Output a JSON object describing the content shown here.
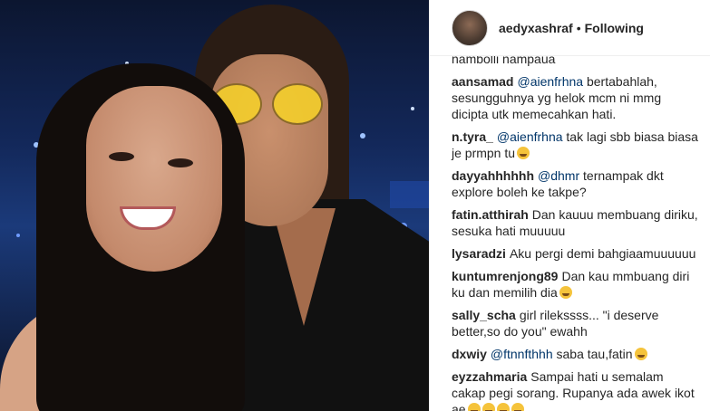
{
  "post": {
    "image_icon": "selfie-photo"
  },
  "header": {
    "username": "aedyxashraf",
    "separator": "•",
    "follow_status": "Following"
  },
  "comments": {
    "partial_top": "nambolli nampaua",
    "items": [
      {
        "user": "aansamad",
        "mention": "@aienfrhna",
        "text": "bertabahlah, sesungguhnya yg helok mcm ni mmg dicipta utk memecahkan hati.",
        "emojis": []
      },
      {
        "user": "n.tyra_",
        "mention": "@aienfrhna",
        "text": "tak lagi sbb biasa biasa je prmpn tu",
        "emojis": [
          "crying-face-emoji"
        ]
      },
      {
        "user": "dayyahhhhhh",
        "mention": "@dhmr",
        "text": "ternampak dkt explore boleh ke takpe?",
        "emojis": []
      },
      {
        "user": "fatin.atthirah",
        "mention": "",
        "text": "Dan kauuu membuang diriku, sesuka hati muuuuu",
        "emojis": []
      },
      {
        "user": "lysaradzi",
        "mention": "",
        "text": "Aku pergi demi bahgiaamuuuuuu",
        "emojis": []
      },
      {
        "user": "kuntumrenjong89",
        "mention": "",
        "text": "Dan kau mmbuang diri ku dan memilih dia",
        "emojis": [
          "sad-face-emoji"
        ]
      },
      {
        "user": "sally_scha",
        "mention": "",
        "text": "girl rilekssss... \"i deserve better,so do you\" ewahh",
        "emojis": []
      },
      {
        "user": "dxwiy",
        "mention": "@ftnnfthhh",
        "text": "saba tau,fatin",
        "emojis": [
          "crying-face-emoji"
        ]
      },
      {
        "user": "eyzzahmaria",
        "mention": "",
        "text": "Sampai hati u semalam cakap pegi sorang. Rupanya ada awek ikot ae",
        "emojis": [
          "crying-face-emoji",
          "crying-face-emoji",
          "crying-face-emoji",
          "crying-face-emoji"
        ]
      }
    ]
  }
}
